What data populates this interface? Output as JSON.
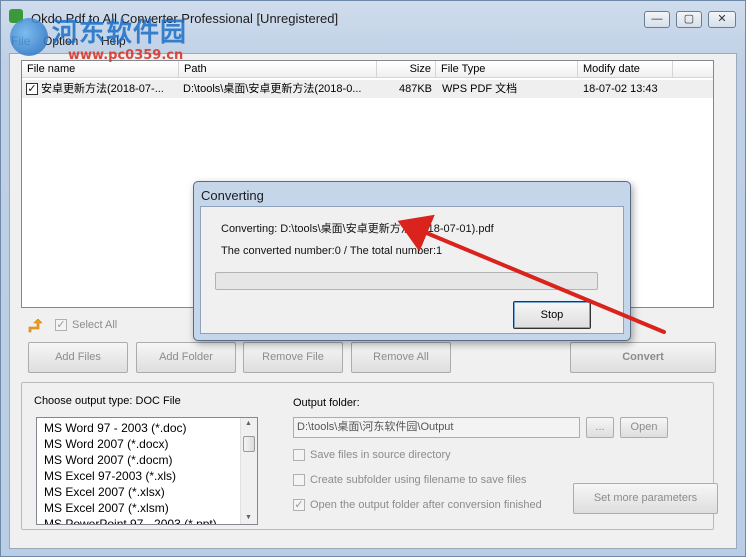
{
  "window": {
    "title": "Okdo Pdf to All Converter Professional [Unregistered]",
    "minimize_glyph": "—",
    "maximize_glyph": "▢",
    "close_glyph": "✕"
  },
  "watermark": {
    "brand": "河东软件园",
    "url": "www.pc0359.cn"
  },
  "menu": {
    "items": [
      {
        "label": "File"
      },
      {
        "label": "Option"
      },
      {
        "label": "Help"
      }
    ]
  },
  "file_list": {
    "columns": [
      "File name",
      "Path",
      "Size",
      "File Type",
      "Modify date"
    ],
    "rows": [
      {
        "checked": true,
        "name": "安卓更新方法(2018-07-...",
        "path": "D:\\tools\\桌面\\安卓更新方法(2018-0...",
        "size": "487KB",
        "type": "WPS PDF 文档",
        "date": "18-07-02 13:43"
      }
    ]
  },
  "toolbar": {
    "select_all_label": "Select All",
    "add_files": "Add Files",
    "add_folder": "Add Folder",
    "remove_file": "Remove File",
    "remove_all": "Remove All",
    "convert": "Convert"
  },
  "output": {
    "type_label": "Choose output type:  DOC File",
    "types": [
      "MS Word 97 - 2003 (*.doc)",
      "MS Word 2007 (*.docx)",
      "MS Word 2007 (*.docm)",
      "MS Excel 97-2003 (*.xls)",
      "MS Excel 2007 (*.xlsx)",
      "MS Excel 2007 (*.xlsm)",
      "MS PowerPoint 97 - 2003 (*.ppt)"
    ],
    "folder_label": "Output folder:",
    "folder_value": "D:\\tools\\桌面\\河东软件园\\Output",
    "browse_label": "...",
    "open_label": "Open",
    "opt_source_dir": "Save files in source directory",
    "opt_subfolder": "Create subfolder using filename to save files",
    "opt_open_after": "Open the output folder after conversion finished",
    "set_more": "Set more parameters"
  },
  "dialog": {
    "title": "Converting",
    "converting_line": "Converting:  D:\\tools\\桌面\\安卓更新方法(2018-07-01).pdf",
    "count_line": "The converted number:0  /  The total number:1",
    "progress_fraction": 0,
    "stop_label": "Stop"
  },
  "colors": {
    "annotation_arrow": "#d9231c",
    "progress_green": "#3fbf3a"
  },
  "icons": {
    "app": "app-icon",
    "up": "up-arrow-icon",
    "check": "✓"
  }
}
